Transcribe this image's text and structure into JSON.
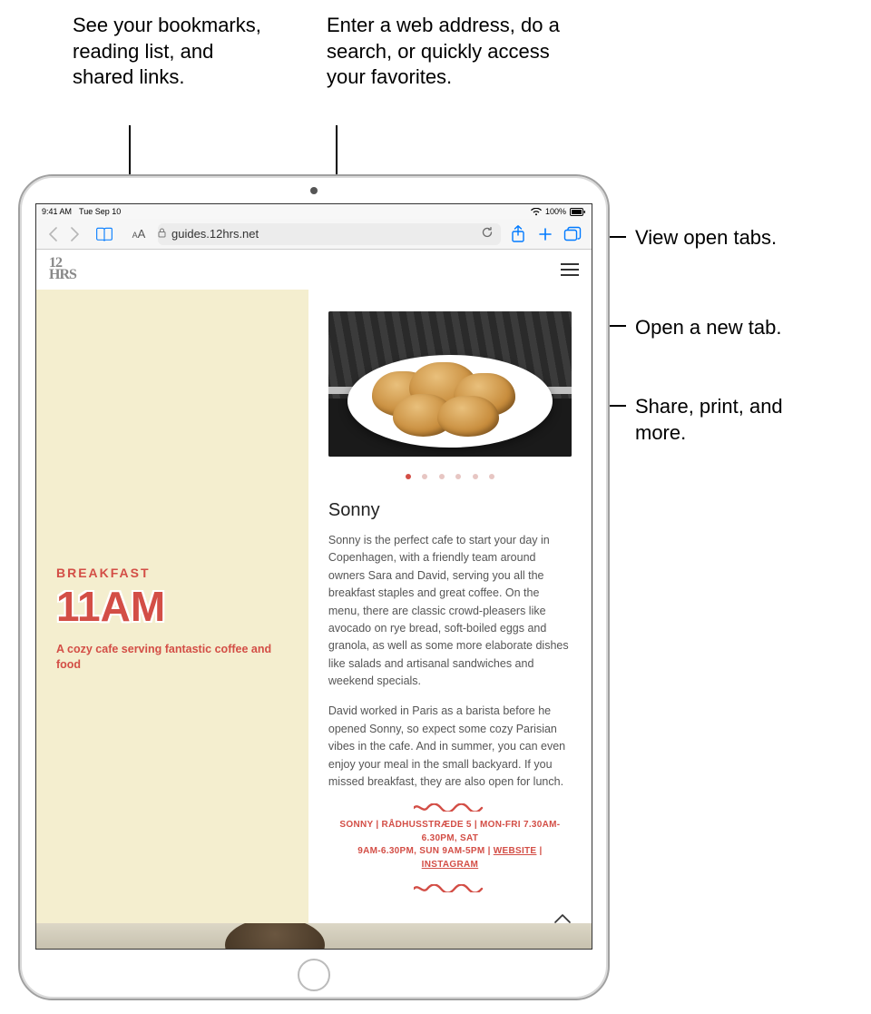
{
  "callouts": {
    "bookmarks": "See your bookmarks, reading list, and shared links.",
    "address": "Enter a web address, do a search, or quickly access your favorites.",
    "tabs": "View open tabs.",
    "newtab": "Open a new tab.",
    "share": "Share, print, and more."
  },
  "statusbar": {
    "time": "9:41 AM",
    "date": "Tue Sep 10",
    "battery": "100%"
  },
  "toolbar": {
    "aa": "AA",
    "url": "guides.12hrs.net"
  },
  "site": {
    "logo_top": "12",
    "logo_bottom": "HRS"
  },
  "left": {
    "kicker": "BREAKFAST",
    "title": "11AM",
    "tag": "A cozy cafe serving fantastic coffee and food"
  },
  "article": {
    "title": "Sonny",
    "p1": "Sonny is the perfect cafe to start your day in Copenhagen, with a friendly team around owners Sara and David, serving you all the breakfast staples and great coffee. On the menu, there are classic crowd-pleasers like avocado on rye bread, soft-boiled eggs and granola, as well as some more elaborate dishes like salads and artisanal sandwiches and weekend specials.",
    "p2": "David worked in Paris as a barista before he opened Sonny, so expect some cozy Parisian vibes in the cafe. And in summer, you can even enjoy your meal in the small backyard. If you missed breakfast, they are also open for lunch."
  },
  "footer": {
    "line1_a": "SONNY | RÅDHUSSTRÆDE 5 | MON-FRI 7.30AM-6.30PM, SAT",
    "line2_a": "9AM-6.30PM, SUN 9AM-5PM | ",
    "website": "WEBSITE",
    "sep": " | ",
    "instagram": "INSTAGRAM"
  }
}
